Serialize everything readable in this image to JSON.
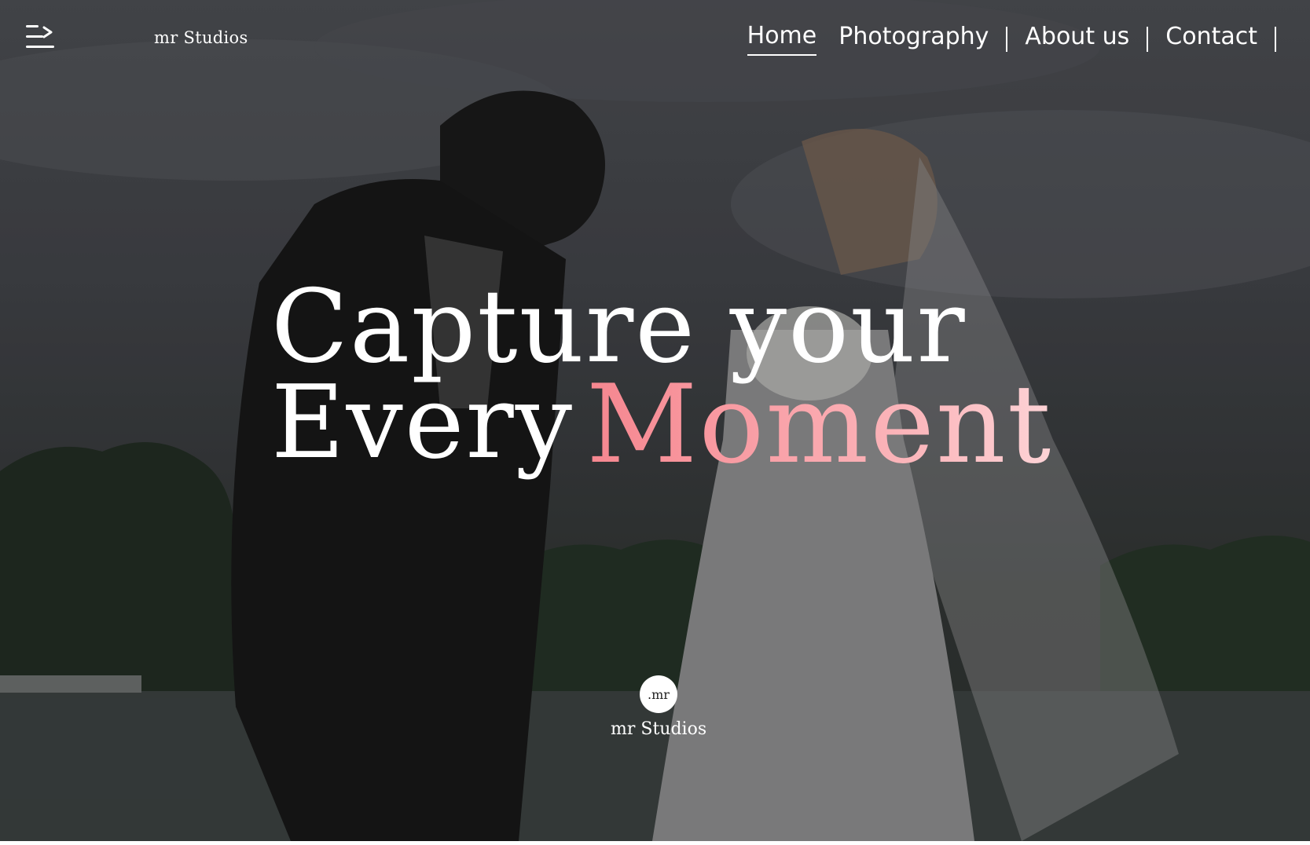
{
  "header": {
    "brand": "mr Studios",
    "menu_icon": "menu-arrow-icon",
    "nav": [
      {
        "label": "Home",
        "active": true
      },
      {
        "label": "Photography",
        "active": false
      },
      {
        "label": "About us",
        "active": false
      },
      {
        "label": "Contact",
        "active": false
      }
    ]
  },
  "hero": {
    "headline_line1": "Capture your",
    "headline_line2_plain": "Every",
    "headline_line2_accent": "Moment",
    "accent_colors": [
      "#f6868f",
      "#fdd3d6"
    ],
    "background_photo": "wedding couple by lake"
  },
  "footer_logo": {
    "badge_text": ".mr",
    "name": "mr Studios"
  }
}
